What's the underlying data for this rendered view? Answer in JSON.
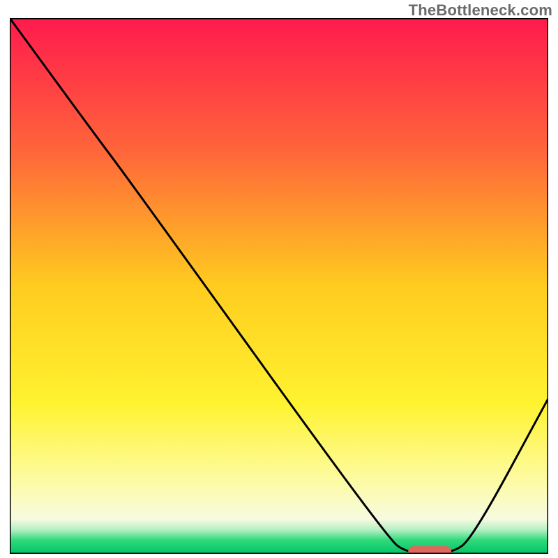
{
  "attribution": "TheBottleneck.com",
  "chart_data": {
    "type": "line",
    "title": "",
    "xlabel": "",
    "ylabel": "",
    "xlim": [
      0,
      100
    ],
    "ylim": [
      0,
      100
    ],
    "background_gradient_stops": [
      {
        "offset": 0.0,
        "color": "#ff1a4d"
      },
      {
        "offset": 0.25,
        "color": "#ff663a"
      },
      {
        "offset": 0.5,
        "color": "#ffcc1f"
      },
      {
        "offset": 0.72,
        "color": "#fff330"
      },
      {
        "offset": 0.86,
        "color": "#fdfba0"
      },
      {
        "offset": 0.935,
        "color": "#f7fbe0"
      },
      {
        "offset": 0.955,
        "color": "#b6f0c3"
      },
      {
        "offset": 0.975,
        "color": "#2ed97a"
      },
      {
        "offset": 1.0,
        "color": "#00c466"
      }
    ],
    "series": [
      {
        "name": "bottleneck-curve",
        "type": "line",
        "color": "#000000",
        "points": [
          {
            "x": 0.0,
            "y": 100.0
          },
          {
            "x": 16.0,
            "y": 78.0
          },
          {
            "x": 22.0,
            "y": 70.0
          },
          {
            "x": 70.0,
            "y": 3.0
          },
          {
            "x": 74.0,
            "y": 0.0
          },
          {
            "x": 82.0,
            "y": 0.0
          },
          {
            "x": 86.0,
            "y": 3.0
          },
          {
            "x": 100.0,
            "y": 29.0
          }
        ]
      },
      {
        "name": "optimal-marker",
        "type": "marker",
        "color": "#e0665f",
        "points": [
          {
            "x": 74.0,
            "y": 0.5
          },
          {
            "x": 82.0,
            "y": 0.5
          }
        ]
      }
    ]
  }
}
